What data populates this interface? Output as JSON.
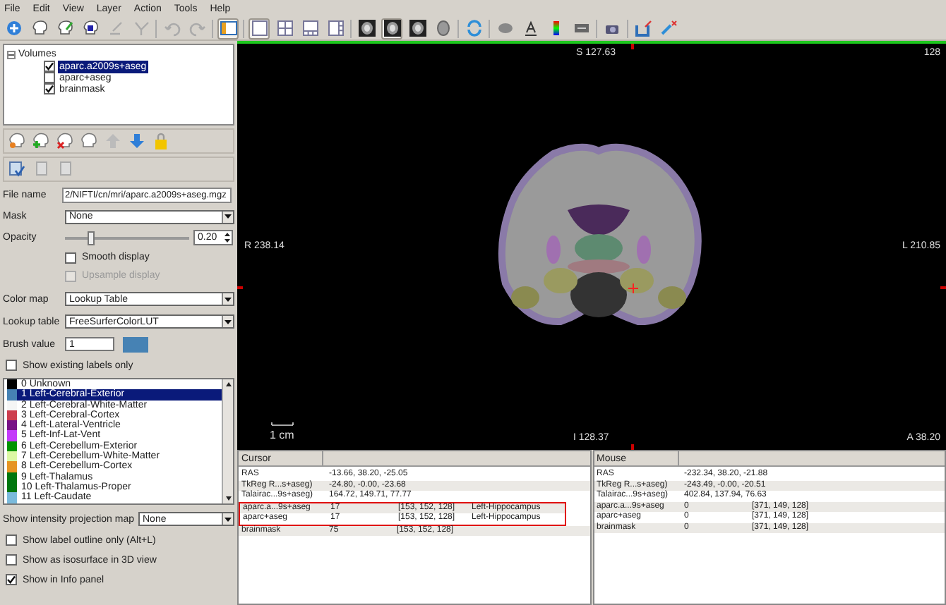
{
  "menu": [
    "File",
    "Edit",
    "View",
    "Layer",
    "Action",
    "Tools",
    "Help"
  ],
  "toolbar": {
    "panel_toggle": {
      "selected": true
    },
    "layouts": [
      {
        "selected": true
      },
      {
        "selected": false
      },
      {
        "selected": false
      },
      {
        "selected": false
      }
    ],
    "views": [
      {
        "selected": false
      },
      {
        "selected": true
      },
      {
        "selected": false
      },
      {
        "selected": false
      }
    ]
  },
  "layer_tree": {
    "label": "Volumes",
    "expanded": true,
    "children": [
      {
        "label": "aparc.a2009s+aseg",
        "checked": true,
        "selected": true
      },
      {
        "label": "aparc+aseg",
        "checked": false,
        "selected": false
      },
      {
        "label": "brainmask",
        "checked": true,
        "selected": false
      }
    ]
  },
  "properties": {
    "file_name": {
      "label": "File name",
      "value": "2/NIFTI/cn/mri/aparc.a2009s+aseg.mgz"
    },
    "mask": {
      "label": "Mask",
      "value": "None"
    },
    "opacity": {
      "label": "Opacity",
      "level": 0.2,
      "value": "0.20"
    },
    "smooth_display": {
      "label": "Smooth display",
      "checked": false,
      "disabled": false
    },
    "upsample_display": {
      "label": "Upsample display",
      "checked": false,
      "disabled": true
    },
    "color_map": {
      "label": "Color map",
      "value": "Lookup Table"
    },
    "lookup_table": {
      "label": "Lookup table",
      "value": "FreeSurferColorLUT"
    },
    "brush_value": {
      "label": "Brush value",
      "value": "1",
      "color": "#4682b4"
    },
    "show_existing": {
      "label": "Show existing labels only",
      "checked": false
    }
  },
  "labels": [
    {
      "label": "0 Unknown",
      "color": "#000000",
      "selected": false
    },
    {
      "label": "1 Left-Cerebral-Exterior",
      "color": "#4682b4",
      "selected": true
    },
    {
      "label": "2 Left-Cerebral-White-Matter",
      "color": "#f5f5f5",
      "selected": false
    },
    {
      "label": "3 Left-Cerebral-Cortex",
      "color": "#cd3e4e",
      "selected": false
    },
    {
      "label": "4 Left-Lateral-Ventricle",
      "color": "#781286",
      "selected": false
    },
    {
      "label": "5 Left-Inf-Lat-Vent",
      "color": "#c43afa",
      "selected": false
    },
    {
      "label": "6 Left-Cerebellum-Exterior",
      "color": "#009400",
      "selected": false
    },
    {
      "label": "7 Left-Cerebellum-White-Matter",
      "color": "#dcf8a4",
      "selected": false
    },
    {
      "label": "8 Left-Cerebellum-Cortex",
      "color": "#e69422",
      "selected": false
    },
    {
      "label": "9 Left-Thalamus",
      "color": "#00760e",
      "selected": false
    },
    {
      "label": "10 Left-Thalamus-Proper",
      "color": "#00760e",
      "selected": false
    },
    {
      "label": "11 Left-Caudate",
      "color": "#7abadc",
      "selected": false
    }
  ],
  "projection_map": {
    "label": "Show intensity projection map",
    "value": "None"
  },
  "options": [
    {
      "label": "Show label outline only (Alt+L)",
      "checked": false
    },
    {
      "label": "Show as isosurface in 3D view",
      "checked": false
    },
    {
      "label": "Show in Info panel",
      "checked": true
    }
  ],
  "viewer": {
    "top": "S 127.63",
    "slice": "128",
    "left": "R 238.14",
    "right": "L 210.85",
    "bottom": "I 128.37",
    "corner": "A 38.20",
    "scale": "1 cm"
  },
  "info_panels": [
    {
      "title": "Cursor",
      "rows": [
        {
          "name": "RAS",
          "value": "-13.66, 38.20, -25.05",
          "highlighted": false
        },
        {
          "name": "TkReg R...s+aseg)",
          "value": "-24.80, -0.00, -23.68",
          "highlighted": false
        },
        {
          "name": "Talairac...9s+aseg)",
          "value": "164.72, 149.71, 77.77",
          "highlighted": false
        },
        {
          "name": "aparc.a...9s+aseg",
          "value": "17",
          "voxel": "[153, 152, 128]",
          "structure": "Left-Hippocampus",
          "highlighted": true
        },
        {
          "name": "aparc+aseg",
          "value": "17",
          "voxel": "[153, 152, 128]",
          "structure": "Left-Hippocampus",
          "highlighted": true
        },
        {
          "name": "brainmask",
          "value": "75",
          "voxel": "[153, 152, 128]",
          "highlighted": false
        }
      ]
    },
    {
      "title": "Mouse",
      "rows": [
        {
          "name": "RAS",
          "value": "-232.34, 38.20, -21.88",
          "highlighted": false
        },
        {
          "name": "TkReg R...s+aseg)",
          "value": "-243.49, -0.00, -20.51",
          "highlighted": false
        },
        {
          "name": "Talairac...9s+aseg)",
          "value": "402.84, 137.94, 76.63",
          "highlighted": false
        },
        {
          "name": "aparc.a...9s+aseg",
          "value": "0",
          "voxel": "[371, 149, 128]",
          "highlighted": false
        },
        {
          "name": "aparc+aseg",
          "value": "0",
          "voxel": "[371, 149, 128]",
          "highlighted": false
        },
        {
          "name": "brainmask",
          "value": "0",
          "voxel": "[371, 149, 128]",
          "highlighted": false
        }
      ]
    }
  ]
}
